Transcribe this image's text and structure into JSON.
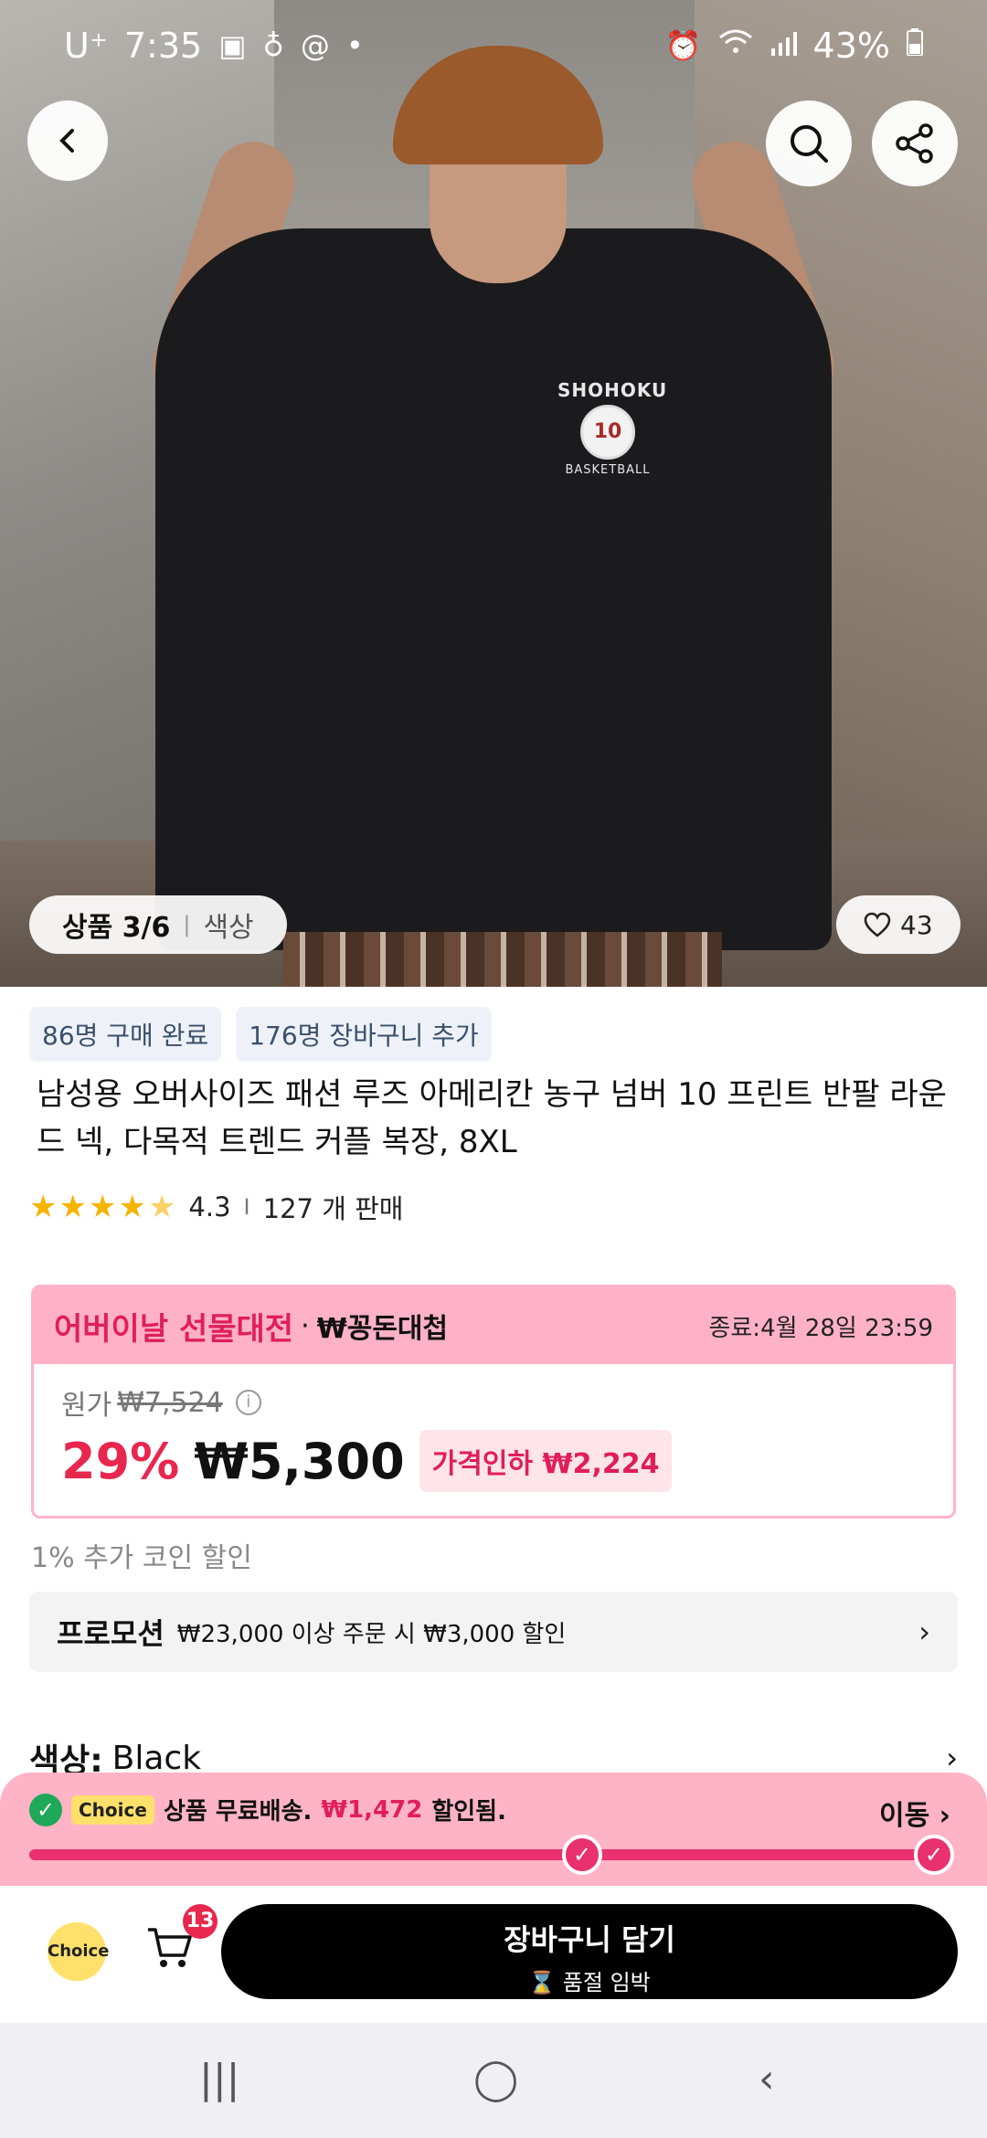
{
  "status_bar": {
    "carrier": "U⁺",
    "time": "7:35",
    "battery": "43%"
  },
  "hero": {
    "logo_text_top": "SHOHOKU",
    "logo_number": "10",
    "logo_text_bottom": "BASKETBALL",
    "pager": "상품 3/6",
    "pager_separator": "|",
    "pager_label": "색상",
    "likes": "43"
  },
  "badges": {
    "purchased": "86명 구매 완료",
    "added_to_cart": "176명 장바구니 추가"
  },
  "product": {
    "title": "남성용 오버사이즈 패션 루즈 아메리칸 농구 넘버 10 프린트 반팔 라운드 넥, 다목적 트렌드 커플 복장, 8XL",
    "rating": "4.3",
    "divider": "I",
    "sold": "127 개 판매"
  },
  "promo_event": {
    "name": "어버이날 선물대전",
    "dot": "·",
    "sub": "₩꽁돈대첩",
    "end": "종료:4월 28일 23:59",
    "orig_label": "원가",
    "orig_price": "₩7,524",
    "discount_pct": "29%",
    "price": "₩5,300",
    "price_drop": "가격인하 ₩2,224"
  },
  "coin_discount": "1% 추가 코인 할인",
  "promotion": {
    "label": "프로모션",
    "text": "₩23,000 이상 주문 시 ₩3,000 할인"
  },
  "color_option": {
    "label": "색상:",
    "value": "Black"
  },
  "shipping_banner": {
    "choice_tag": "Choice",
    "text": "상품 무료배송.",
    "amount": "₩1,472",
    "suffix": "할인됨.",
    "go": "이동 ›",
    "progress": 1.0
  },
  "action_bar": {
    "choice_logo": "Choice",
    "cart_count": "13",
    "cta_main": "장바구니 담기",
    "cta_sub": "⌛ 품절 임박"
  },
  "nav": {
    "recents": "|||",
    "home": "◯",
    "back": "‹"
  },
  "colors": {
    "accent_pink": "#e8316e",
    "banner_pink": "#ffb3c7",
    "price_red": "#e8274f",
    "star": "#f5b400"
  }
}
